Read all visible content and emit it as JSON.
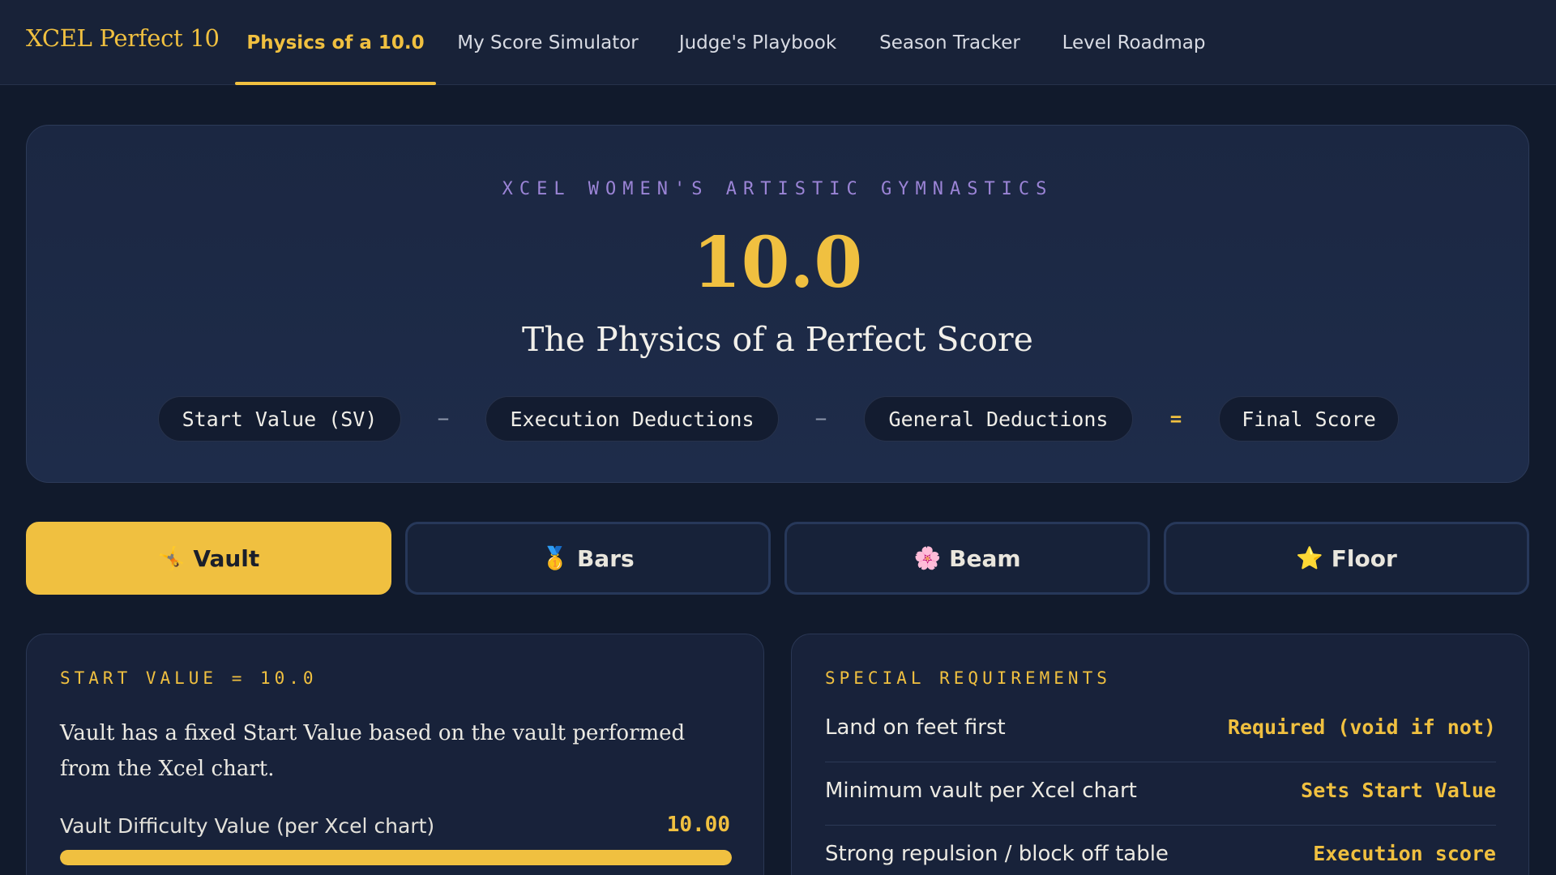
{
  "brand": "XCEL Perfect 10",
  "nav": {
    "tabs": [
      {
        "label": "Physics of a 10.0",
        "active": true
      },
      {
        "label": "My Score Simulator",
        "active": false
      },
      {
        "label": "Judge's Playbook",
        "active": false
      },
      {
        "label": "Season Tracker",
        "active": false
      },
      {
        "label": "Level Roadmap",
        "active": false
      }
    ]
  },
  "hero": {
    "eyebrow": "XCEL WOMEN'S ARTISTIC GYMNASTICS",
    "score": "10.0",
    "title": "The Physics of a Perfect Score",
    "formula": {
      "terms": [
        "Start Value (SV)",
        "Execution Deductions",
        "General Deductions",
        "Final Score"
      ],
      "operators": [
        "−",
        "−",
        "="
      ]
    }
  },
  "events": [
    {
      "emoji": "🤸",
      "label": "Vault",
      "active": true
    },
    {
      "emoji": "🥇",
      "label": "Bars",
      "active": false
    },
    {
      "emoji": "🌸",
      "label": "Beam",
      "active": false
    },
    {
      "emoji": "⭐",
      "label": "Floor",
      "active": false
    }
  ],
  "start_value_card": {
    "heading": "START VALUE = 10.0",
    "text": "Vault has a fixed Start Value based on the vault performed from the Xcel chart.",
    "metric": {
      "label": "Vault Difficulty Value (per Xcel chart)",
      "value": "10.00",
      "fill_fraction": 1.0
    }
  },
  "requirements_card": {
    "heading": "SPECIAL REQUIREMENTS",
    "rows": [
      {
        "label": "Land on feet first",
        "value": "Required (void if not)"
      },
      {
        "label": "Minimum vault per Xcel chart",
        "value": "Sets Start Value"
      },
      {
        "label": "Strong repulsion / block off table",
        "value": "Execution score"
      }
    ]
  },
  "colors": {
    "accent": "#f0c040",
    "background": "#111a2c",
    "panel": "#18223a",
    "eyebrow": "#9b84d6"
  }
}
